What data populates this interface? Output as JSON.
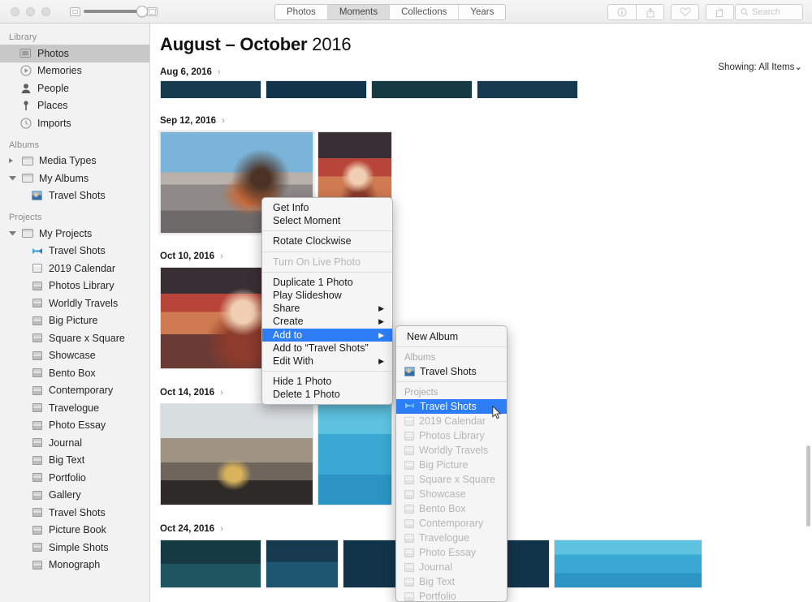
{
  "toolbar": {
    "traffic_lights": [
      "close",
      "minimize",
      "zoom"
    ],
    "zoom_slider": {
      "min_icon": "small-thumbnail-icon",
      "max_icon": "large-thumbnail-icon",
      "value": 92
    },
    "segments": [
      {
        "label": "Photos",
        "active": false
      },
      {
        "label": "Moments",
        "active": true
      },
      {
        "label": "Collections",
        "active": false
      },
      {
        "label": "Years",
        "active": false
      }
    ],
    "icons": [
      {
        "name": "info-icon",
        "glyph": "ⓘ"
      },
      {
        "name": "share-icon",
        "glyph": "↑"
      },
      {
        "name": "favorite-heart-icon",
        "glyph": "♡"
      },
      {
        "name": "rotate-icon",
        "glyph": "↷"
      }
    ],
    "search": {
      "placeholder": "Search",
      "value": "",
      "icon": "search-icon"
    }
  },
  "sidebar": {
    "sections": [
      {
        "title": "Library",
        "items": [
          {
            "label": "Photos",
            "icon": "photos-icon",
            "selected": true,
            "indent": 1
          },
          {
            "label": "Memories",
            "icon": "memories-icon",
            "selected": false,
            "indent": 1
          },
          {
            "label": "People",
            "icon": "people-icon",
            "selected": false,
            "indent": 1
          },
          {
            "label": "Places",
            "icon": "places-pin-icon",
            "selected": false,
            "indent": 1
          },
          {
            "label": "Imports",
            "icon": "imports-clock-icon",
            "selected": false,
            "indent": 1
          }
        ]
      },
      {
        "title": "Albums",
        "items": [
          {
            "label": "Media Types",
            "icon": "folder-icon",
            "disclosure": "closed",
            "indent": 0
          },
          {
            "label": "My Albums",
            "icon": "folder-icon",
            "disclosure": "open",
            "indent": 0
          },
          {
            "label": "Travel Shots",
            "icon": "album-thumbnail-icon",
            "indent": 2
          }
        ]
      },
      {
        "title": "Projects",
        "items": [
          {
            "label": "My Projects",
            "icon": "folder-icon",
            "disclosure": "open",
            "indent": 0
          },
          {
            "label": "Travel Shots",
            "icon": "project-bowtie-icon",
            "indent": 2
          },
          {
            "label": "2019 Calendar",
            "icon": "calendar-book-icon",
            "indent": 2
          },
          {
            "label": "Photos Library",
            "icon": "book-icon",
            "indent": 2
          },
          {
            "label": "Worldly Travels",
            "icon": "book-icon",
            "indent": 2
          },
          {
            "label": "Big Picture",
            "icon": "book-icon",
            "indent": 2
          },
          {
            "label": "Square x Square",
            "icon": "book-icon",
            "indent": 2
          },
          {
            "label": "Showcase",
            "icon": "book-icon",
            "indent": 2
          },
          {
            "label": "Bento Box",
            "icon": "book-icon",
            "indent": 2
          },
          {
            "label": "Contemporary",
            "icon": "book-icon",
            "indent": 2
          },
          {
            "label": "Travelogue",
            "icon": "book-icon",
            "indent": 2
          },
          {
            "label": "Photo Essay",
            "icon": "book-icon",
            "indent": 2
          },
          {
            "label": "Journal",
            "icon": "book-icon",
            "indent": 2
          },
          {
            "label": "Big Text",
            "icon": "book-icon",
            "indent": 2
          },
          {
            "label": "Portfolio",
            "icon": "book-icon",
            "indent": 2
          },
          {
            "label": "Gallery",
            "icon": "book-icon",
            "indent": 2
          },
          {
            "label": "Travel Shots",
            "icon": "book-icon",
            "indent": 2
          },
          {
            "label": "Picture Book",
            "icon": "book-icon",
            "indent": 2
          },
          {
            "label": "Simple Shots",
            "icon": "book-icon",
            "indent": 2
          },
          {
            "label": "Monograph",
            "icon": "book-icon",
            "indent": 2
          }
        ]
      }
    ]
  },
  "main": {
    "title_range": "August – October",
    "title_year": "2016",
    "showing_label": "Showing: All Items",
    "showing_chevron": "⌄",
    "moments": [
      {
        "date": "Aug 6, 2016",
        "chevron": "›"
      },
      {
        "date": "Sep 12, 2016",
        "chevron": "›"
      },
      {
        "date": "Oct 10, 2016",
        "chevron": "›"
      },
      {
        "date": "Oct 14, 2016",
        "chevron": "›"
      },
      {
        "date": "Oct 24, 2016",
        "chevron": "›"
      }
    ]
  },
  "context_menu": {
    "groups": [
      [
        {
          "label": "Get Info",
          "state": "normal"
        },
        {
          "label": "Select Moment",
          "state": "normal"
        }
      ],
      [
        {
          "label": "Rotate Clockwise",
          "state": "normal"
        }
      ],
      [
        {
          "label": "Turn On Live Photo",
          "state": "disabled"
        }
      ],
      [
        {
          "label": "Duplicate 1 Photo",
          "state": "normal"
        },
        {
          "label": "Play Slideshow",
          "state": "normal"
        },
        {
          "label": "Share",
          "state": "normal",
          "submenu": true
        },
        {
          "label": "Create",
          "state": "normal",
          "submenu": true
        },
        {
          "label": "Add to",
          "state": "highlighted",
          "submenu": true
        },
        {
          "label": "Add to “Travel Shots”",
          "state": "normal"
        },
        {
          "label": "Edit With",
          "state": "normal",
          "submenu": true
        }
      ],
      [
        {
          "label": "Hide 1 Photo",
          "state": "normal"
        },
        {
          "label": "Delete 1 Photo",
          "state": "normal"
        }
      ]
    ],
    "submenu_arrow": "▶"
  },
  "submenu": {
    "new_album": "New Album",
    "albums_header": "Albums",
    "albums": [
      {
        "label": "Travel Shots",
        "icon": "album-thumbnail-icon",
        "state": "normal"
      }
    ],
    "projects_header": "Projects",
    "projects": [
      {
        "label": "Travel Shots",
        "icon": "project-bowtie-icon",
        "state": "highlighted"
      },
      {
        "label": "2019 Calendar",
        "icon": "calendar-book-icon",
        "state": "dim"
      },
      {
        "label": "Photos Library",
        "icon": "book-icon",
        "state": "dim"
      },
      {
        "label": "Worldly Travels",
        "icon": "book-icon",
        "state": "dim"
      },
      {
        "label": "Big Picture",
        "icon": "book-icon",
        "state": "dim"
      },
      {
        "label": "Square x Square",
        "icon": "book-icon",
        "state": "dim"
      },
      {
        "label": "Showcase",
        "icon": "book-icon",
        "state": "dim"
      },
      {
        "label": "Bento Box",
        "icon": "book-icon",
        "state": "dim"
      },
      {
        "label": "Contemporary",
        "icon": "book-icon",
        "state": "dim"
      },
      {
        "label": "Travelogue",
        "icon": "book-icon",
        "state": "dim"
      },
      {
        "label": "Photo Essay",
        "icon": "book-icon",
        "state": "dim"
      },
      {
        "label": "Journal",
        "icon": "book-icon",
        "state": "dim"
      },
      {
        "label": "Big Text",
        "icon": "book-icon",
        "state": "dim"
      },
      {
        "label": "Portfolio",
        "icon": "book-icon",
        "state": "dim"
      }
    ]
  },
  "colors": {
    "accent": "#2d7df6",
    "sidebar_bg": "#f2f2f2",
    "menu_bg": "#f5f5f5",
    "selected_sidebar": "#c8c8c8"
  }
}
